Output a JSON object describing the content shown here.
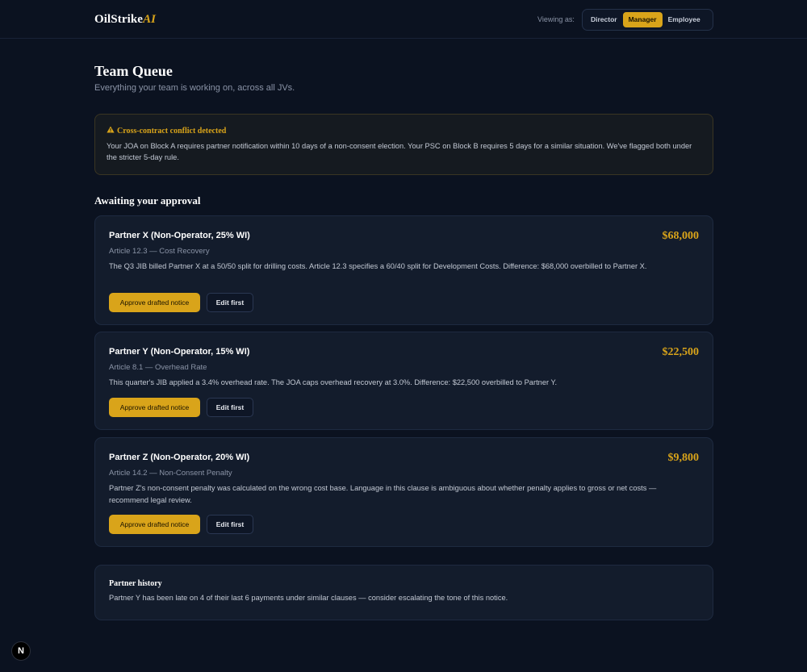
{
  "header": {
    "brand_main": "OilStrike",
    "brand_ai": "AI",
    "viewing_as_label": "Viewing as:",
    "roles": [
      "Director",
      "Manager",
      "Employee"
    ],
    "active_role": "Manager"
  },
  "page": {
    "title": "Team Queue",
    "subtitle": "Everything your team is working on, across all JVs."
  },
  "alert": {
    "icon": "warning-icon",
    "title": "Cross-contract conflict detected",
    "body": "Your JOA on Block A requires partner notification within 10 days of a non-consent election. Your PSC on Block B requires 5 days for a similar situation. We've flagged both under the stricter 5-day rule."
  },
  "approvals": {
    "section_title": "Awaiting your approval",
    "items": [
      {
        "partner": "Partner X (Non-Operator, 25% WI)",
        "article": "Article 12.3 — Cost Recovery",
        "description": "The Q3 JIB billed Partner X at a 50/50 split for drilling costs. Article 12.3 specifies a 60/40 split for Development Costs. Difference: $68,000 overbilled to Partner X.",
        "amount": "$68,000",
        "approve_label": "Approve drafted notice",
        "edit_label": "Edit first"
      },
      {
        "partner": "Partner Y (Non-Operator, 15% WI)",
        "article": "Article 8.1 — Overhead Rate",
        "description": "This quarter's JIB applied a 3.4% overhead rate. The JOA caps overhead recovery at 3.0%. Difference: $22,500 overbilled to Partner Y.",
        "amount": "$22,500",
        "approve_label": "Approve drafted notice",
        "edit_label": "Edit first"
      },
      {
        "partner": "Partner Z (Non-Operator, 20% WI)",
        "article": "Article 14.2 — Non-Consent Penalty",
        "description": "Partner Z's non-consent penalty was calculated on the wrong cost base. Language in this clause is ambiguous about whether penalty applies to gross or net costs — recommend legal review.",
        "amount": "$9,800",
        "approve_label": "Approve drafted notice",
        "edit_label": "Edit first"
      }
    ]
  },
  "history": {
    "title": "Partner history",
    "body": "Partner Y has been late on 4 of their last 6 payments under similar clauses — consider escalating the tone of this notice."
  },
  "dev_badge": {
    "icon": "nextjs-icon",
    "letter": "N"
  },
  "colors": {
    "background": "#0b1220",
    "card": "#131c2c",
    "accent": "#d9a41a"
  }
}
